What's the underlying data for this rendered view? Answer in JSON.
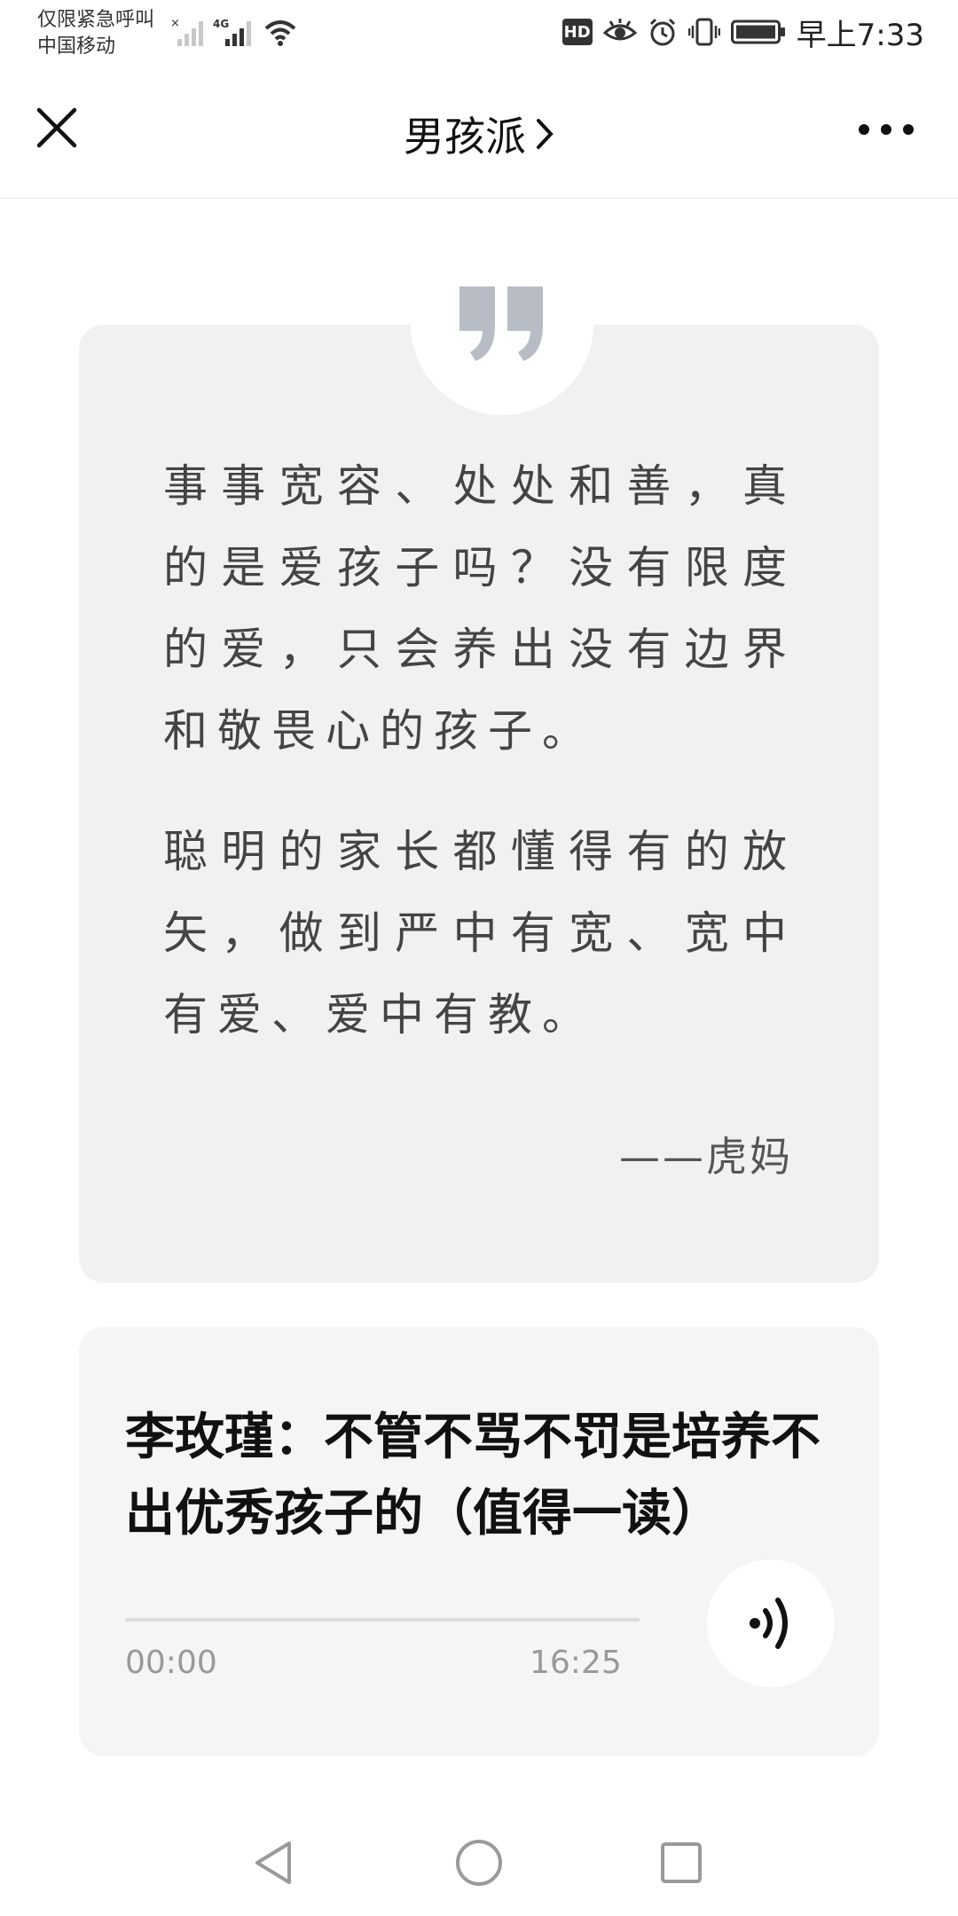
{
  "status_bar": {
    "line1": "仅限紧急呼叫",
    "line2": "中国移动",
    "network": "4G",
    "hd": "HD",
    "time": "早上7:33"
  },
  "nav": {
    "title": "男孩派",
    "close_icon": "close-icon",
    "more_icon": "more-icon"
  },
  "quote": {
    "paragraphs": [
      "事事宽容、处处和善，真的是爱孩子吗？没有限度的爱，只会养出没有边界和敬畏心的孩子。",
      "聪明的家长都懂得有的放矢，做到严中有宽、宽中有爱、爱中有教。"
    ],
    "author": "——虎妈"
  },
  "audio": {
    "title": "李玫瑾：不管不骂不罚是培养不出优秀孩子的（值得一读）",
    "time_start": "00:00",
    "time_end": "16:25",
    "progress": 0
  },
  "colors": {
    "card_bg": "#f1f1f2",
    "text": "#444444",
    "muted": "#999999"
  }
}
